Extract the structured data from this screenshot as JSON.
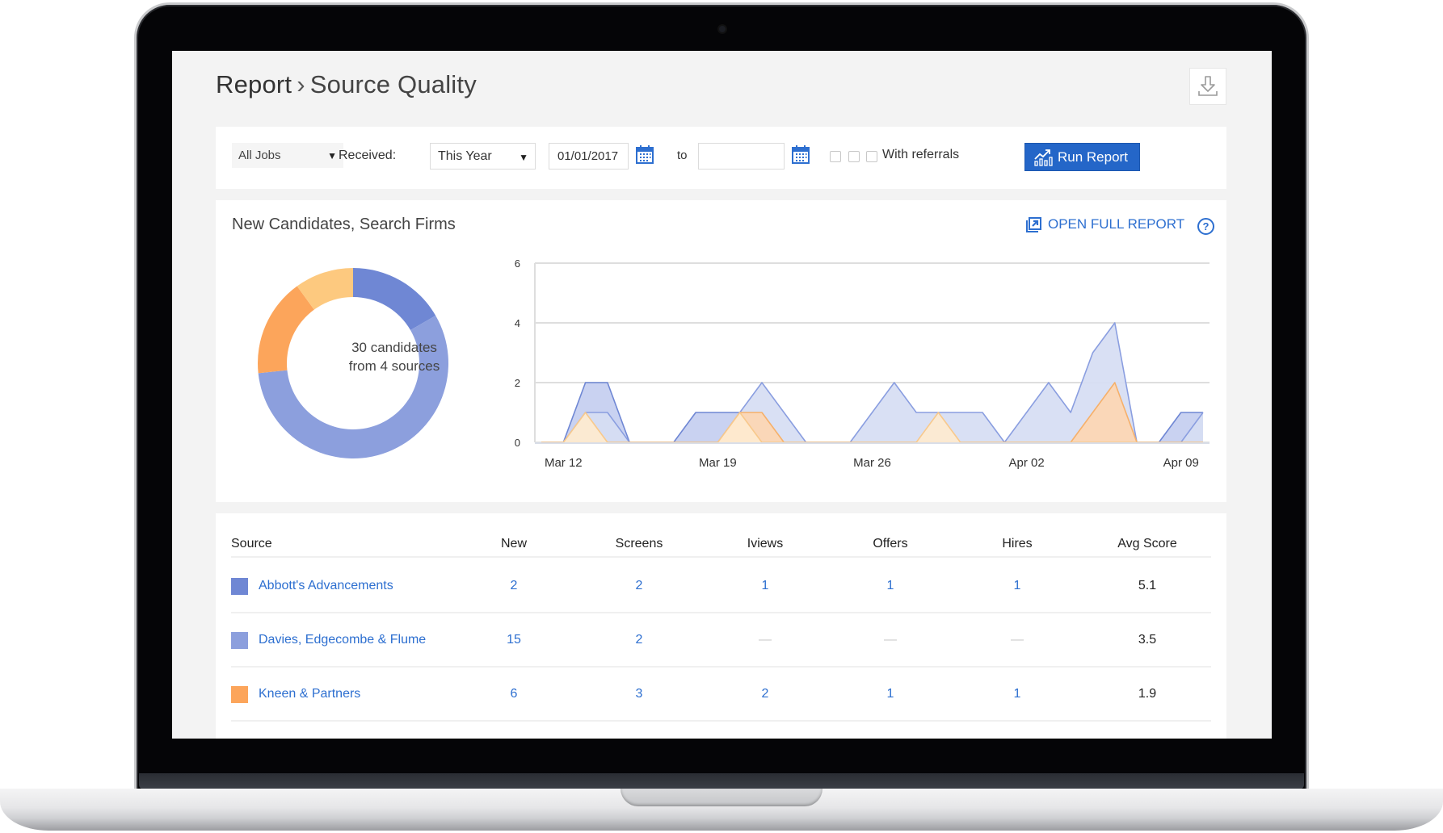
{
  "header": {
    "breadcrumb_root": "Report",
    "breadcrumb_separator": "›",
    "breadcrumb_current": "Source Quality",
    "download_icon": "download-icon"
  },
  "filters": {
    "jobs_select": "All Jobs",
    "received_label": "Received:",
    "period_select": "This Year",
    "date_from": "01/01/2017",
    "date_to": "",
    "to_label": "to",
    "calendar_icon": "calendar-icon",
    "checkboxes": [
      false,
      false,
      false
    ],
    "referrals_label": "With referrals",
    "run_button": "Run Report",
    "run_icon": "chart-growth-icon"
  },
  "chart_card": {
    "title": "New Candidates, Search Firms",
    "open_full_report": "OPEN FULL REPORT",
    "help_icon": "question-circle-icon",
    "donut_center_line1": "30 candidates",
    "donut_center_line2": "from 4 sources"
  },
  "colors": {
    "accent": "#2466c8",
    "link": "#2d6fd0",
    "series": [
      "#6f87d4",
      "#8c9fdd",
      "#fca55b",
      "#fdc97f"
    ]
  },
  "chart_data": [
    {
      "type": "pie",
      "title": "New Candidates, Search Firms",
      "donut": true,
      "center_label": "30 candidates from 4 sources",
      "labels": [
        "Abbott's Advancements",
        "Davies, Edgecombe & Flume",
        "Kneen & Partners",
        ""
      ],
      "values": [
        5,
        17,
        5,
        3
      ],
      "colors": [
        "#6f87d4",
        "#8c9fdd",
        "#fca55b",
        "#fdc97f"
      ]
    },
    {
      "type": "area",
      "title": "",
      "xlabel": "",
      "ylabel": "",
      "ylim": [
        0,
        6
      ],
      "yticks": [
        0,
        2,
        4,
        6
      ],
      "grid": true,
      "x": [
        "Mar 11",
        "Mar 12",
        "Mar 13",
        "Mar 14",
        "Mar 15",
        "Mar 16",
        "Mar 17",
        "Mar 18",
        "Mar 19",
        "Mar 20",
        "Mar 21",
        "Mar 22",
        "Mar 23",
        "Mar 24",
        "Mar 25",
        "Mar 26",
        "Mar 27",
        "Mar 28",
        "Mar 29",
        "Mar 30",
        "Mar 31",
        "Apr 01",
        "Apr 02",
        "Apr 03",
        "Apr 04",
        "Apr 05",
        "Apr 06",
        "Apr 07",
        "Apr 08",
        "Apr 09",
        "Apr 10"
      ],
      "xtick_labels": [
        "Mar 12",
        "Mar 19",
        "Mar 26",
        "Apr 02",
        "Apr 09"
      ],
      "series": [
        {
          "name": "Abbott's Advancements",
          "fill": "#c4cef0",
          "stroke": "#6f87d4",
          "values": [
            0,
            0,
            2,
            2,
            0,
            0,
            0,
            1,
            1,
            1,
            0,
            0,
            0,
            0,
            0,
            0,
            0,
            0,
            0,
            0,
            0,
            0,
            0,
            0,
            0,
            0,
            0,
            0,
            0,
            1,
            1
          ]
        },
        {
          "name": "Davies, Edgecombe & Flume",
          "fill": "#d6ddf3",
          "stroke": "#8a9ee0",
          "values": [
            0,
            0,
            1,
            1,
            0,
            0,
            0,
            0,
            0,
            1,
            2,
            1,
            0,
            0,
            0,
            1,
            2,
            1,
            1,
            1,
            1,
            0,
            1,
            2,
            1,
            3,
            4,
            0,
            0,
            0,
            1
          ]
        },
        {
          "name": "Kneen & Partners",
          "fill": "#fdd6b2",
          "stroke": "#f6b06a",
          "values": [
            0,
            0,
            0,
            0,
            0,
            0,
            0,
            0,
            0,
            1,
            1,
            0,
            0,
            0,
            0,
            0,
            0,
            0,
            0,
            0,
            0,
            0,
            0,
            0,
            0,
            1,
            2,
            0,
            0,
            0,
            0
          ]
        },
        {
          "name": "",
          "fill": "#feeacf",
          "stroke": "#f8c98c",
          "values": [
            0,
            0,
            1,
            0,
            0,
            0,
            0,
            0,
            0,
            1,
            0,
            0,
            0,
            0,
            0,
            0,
            0,
            0,
            1,
            0,
            0,
            0,
            0,
            0,
            0,
            0,
            0,
            0,
            0,
            0,
            0
          ]
        }
      ]
    }
  ],
  "table": {
    "columns": [
      "Source",
      "New",
      "Screens",
      "Iviews",
      "Offers",
      "Hires",
      "Avg Score"
    ],
    "rows": [
      {
        "source": "Abbott's Advancements",
        "color": "#6f87d4",
        "new": "2",
        "screens": "2",
        "iviews": "1",
        "offers": "1",
        "hires": "1",
        "avg_score": "5.1"
      },
      {
        "source": "Davies, Edgecombe & Flume",
        "color": "#8c9fdd",
        "new": "15",
        "screens": "2",
        "iviews": "—",
        "offers": "—",
        "hires": "—",
        "avg_score": "3.5"
      },
      {
        "source": "Kneen & Partners",
        "color": "#fca55b",
        "new": "6",
        "screens": "3",
        "iviews": "2",
        "offers": "1",
        "hires": "1",
        "avg_score": "1.9"
      },
      {
        "source": "",
        "color": "#fdc97f",
        "new": "",
        "screens": "",
        "iviews": "",
        "offers": "",
        "hires": "",
        "avg_score": ""
      }
    ]
  }
}
